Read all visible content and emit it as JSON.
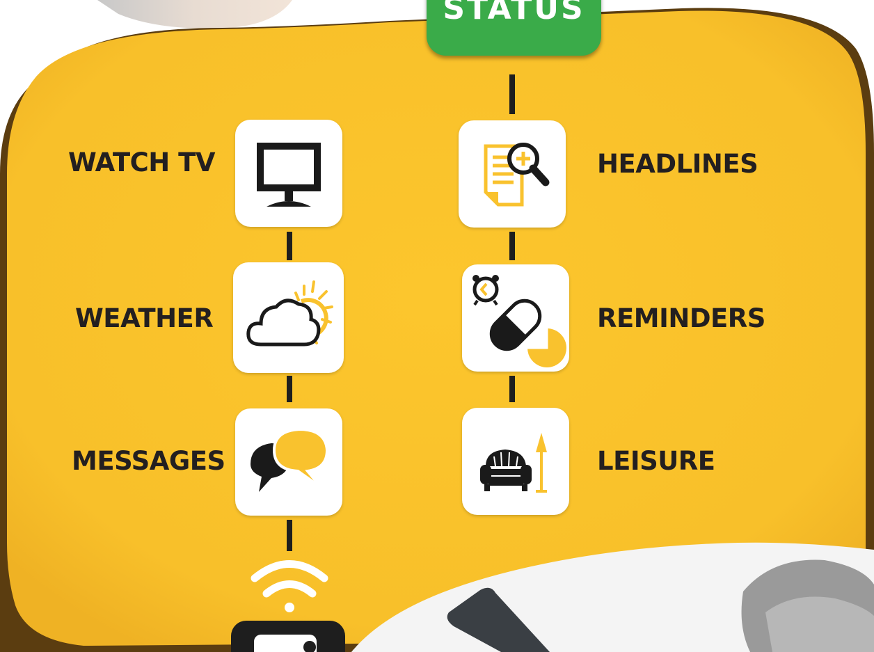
{
  "header": {
    "status_label": "STATUS"
  },
  "menu": {
    "left": [
      {
        "label": "WATCH TV",
        "icon": "tv-icon"
      },
      {
        "label": "WEATHER",
        "icon": "weather-icon"
      },
      {
        "label": "MESSAGES",
        "icon": "chat-bubbles-icon"
      }
    ],
    "right": [
      {
        "label": "HEADLINES",
        "icon": "news-search-icon"
      },
      {
        "label": "REMINDERS",
        "icon": "pill-alarm-icon"
      },
      {
        "label": "LEISURE",
        "icon": "sofa-lamp-icon"
      }
    ]
  },
  "colors": {
    "panel": "#f9c22e",
    "panel_shadow": "#6b4a12",
    "status": "#3aab49",
    "accent_icon": "#f9c22e",
    "text": "#231f20"
  }
}
